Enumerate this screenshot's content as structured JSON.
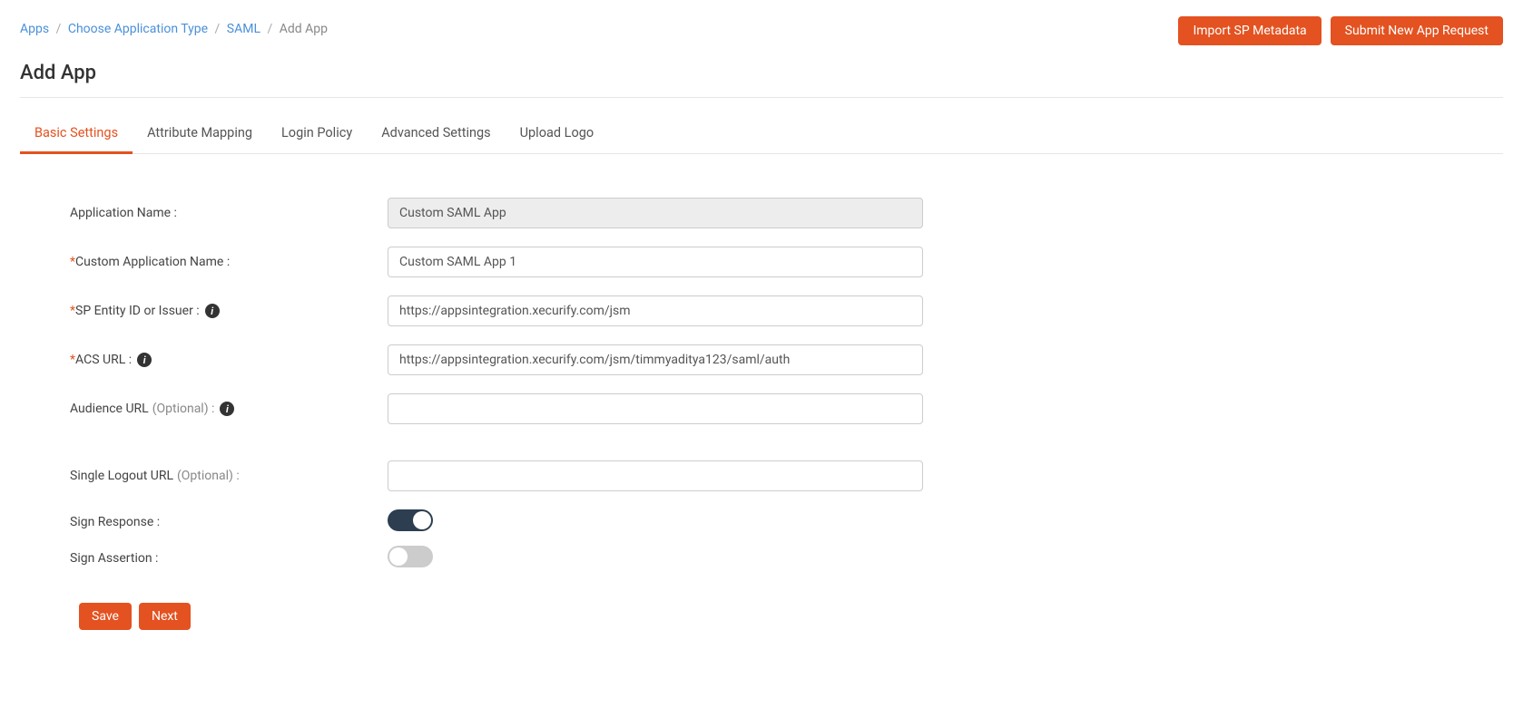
{
  "breadcrumb": {
    "items": [
      {
        "label": "Apps",
        "link": true
      },
      {
        "label": "Choose Application Type",
        "link": true
      },
      {
        "label": "SAML",
        "link": true
      },
      {
        "label": "Add App",
        "link": false
      }
    ]
  },
  "top_buttons": {
    "import_metadata": "Import SP Metadata",
    "submit_request": "Submit New App Request"
  },
  "page_title": "Add App",
  "tabs": [
    {
      "label": "Basic Settings",
      "active": true
    },
    {
      "label": "Attribute Mapping",
      "active": false
    },
    {
      "label": "Login Policy",
      "active": false
    },
    {
      "label": "Advanced Settings",
      "active": false
    },
    {
      "label": "Upload Logo",
      "active": false
    }
  ],
  "fields": {
    "app_name": {
      "label": "Application Name :",
      "value": "Custom SAML App",
      "readonly": true
    },
    "custom_app_name": {
      "label_pre": "Custom Application Name :",
      "value": "Custom SAML App 1"
    },
    "sp_entity": {
      "label_pre": "SP Entity ID or Issuer :",
      "value": "https://appsintegration.xecurify.com/jsm"
    },
    "acs_url": {
      "label_pre": "ACS URL :",
      "value": "https://appsintegration.xecurify.com/jsm/timmyaditya123/saml/auth"
    },
    "audience_url": {
      "label_main": "Audience URL",
      "label_opt": "(Optional) :",
      "value": ""
    },
    "slo_url": {
      "label_main": "Single Logout URL",
      "label_opt": "(Optional) :",
      "value": ""
    },
    "sign_response": {
      "label": "Sign Response :",
      "on": true
    },
    "sign_assertion": {
      "label": "Sign Assertion :",
      "on": false
    }
  },
  "actions": {
    "save": "Save",
    "next": "Next"
  },
  "info_glyph": "i"
}
